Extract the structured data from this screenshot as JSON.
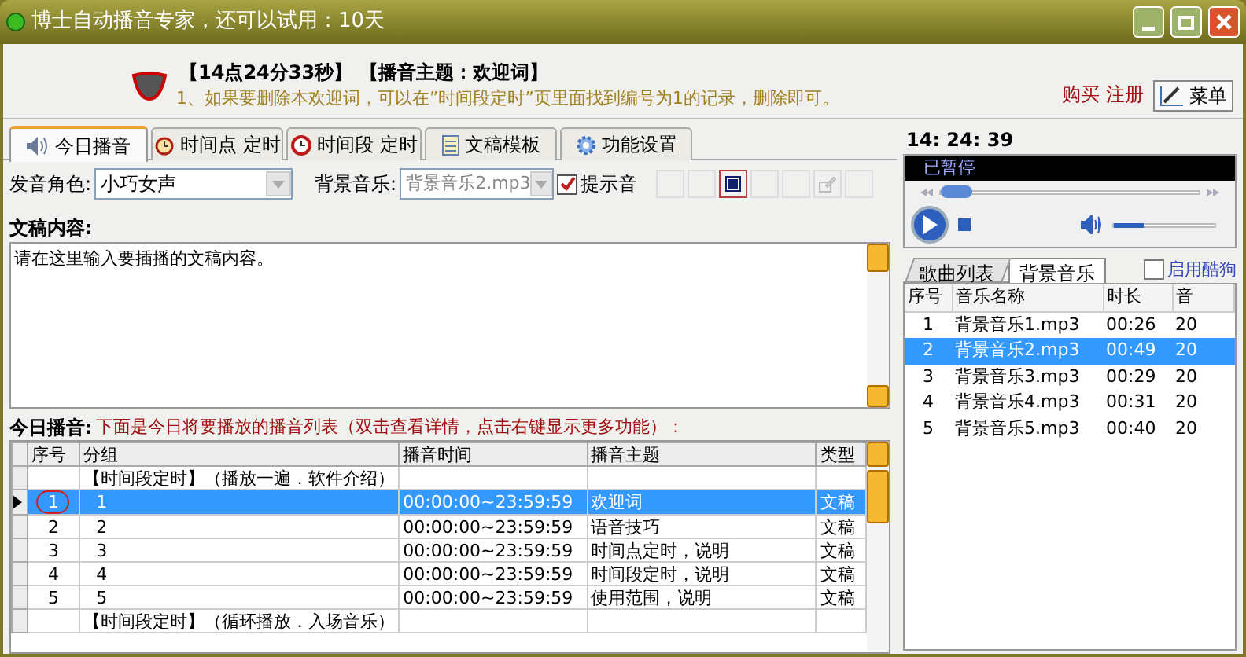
{
  "window": {
    "title": "博士自动播音专家，还可以试用：10天"
  },
  "header": {
    "headline": "【14点24分33秒】 【播音主题：欢迎词】",
    "hint": "1、如果要删除本欢迎词，可以在”时间段定时”页里面找到编号为1的记录，删除即可。",
    "links": [
      "购买",
      "注册"
    ],
    "menu_button": "菜单"
  },
  "tabs": [
    {
      "label": "今日播音",
      "selected": true
    },
    {
      "label": "时间点 定时",
      "selected": false
    },
    {
      "label": "时间段 定时",
      "selected": false
    },
    {
      "label": "文稿模板",
      "selected": false
    },
    {
      "label": "功能设置",
      "selected": false
    }
  ],
  "voice": {
    "label": "发音角色:",
    "value": "小巧女声"
  },
  "background_music": {
    "label": "背景音乐:",
    "value": "背景音乐2.mp3"
  },
  "prompt_tone": {
    "label": "提示音",
    "checked": true
  },
  "script": {
    "label": "文稿内容:",
    "placeholder": "请在这里输入要插播的文稿内容。"
  },
  "today": {
    "label": "今日播音:",
    "note": "下面是今日将要播放的播音列表（双击查看详情，点击右键显示更多功能）："
  },
  "table": {
    "columns": [
      "序号",
      "分组",
      "播音时间",
      "播音主题",
      "类型"
    ],
    "rows": [
      {
        "kind": "group",
        "cells": [
          "",
          "【时间段定时】（播放一遍．软件介绍）",
          "",
          "",
          ""
        ],
        "selected": false
      },
      {
        "kind": "item",
        "cells": [
          "1",
          "1",
          "00:00:00~23:59:59",
          "欢迎词",
          "文稿"
        ],
        "selected": true
      },
      {
        "kind": "item",
        "cells": [
          "2",
          "2",
          "00:00:00~23:59:59",
          "语音技巧",
          "文稿"
        ],
        "selected": false
      },
      {
        "kind": "item",
        "cells": [
          "3",
          "3",
          "00:00:00~23:59:59",
          "时间点定时，说明",
          "文稿"
        ],
        "selected": false
      },
      {
        "kind": "item",
        "cells": [
          "4",
          "4",
          "00:00:00~23:59:59",
          "时间段定时，说明",
          "文稿"
        ],
        "selected": false
      },
      {
        "kind": "item",
        "cells": [
          "5",
          "5",
          "00:00:00~23:59:59",
          "使用范围，说明",
          "文稿"
        ],
        "selected": false
      },
      {
        "kind": "group",
        "cells": [
          "",
          "【时间段定时】（循环播放．入场音乐）",
          "",
          "",
          ""
        ],
        "selected": false
      }
    ]
  },
  "clock": "14: 24: 39",
  "player": {
    "status": "已暂停",
    "seek": {
      "level": 0.12
    },
    "volume": {
      "level": 0.3
    }
  },
  "music_tabs": [
    {
      "label": "歌曲列表",
      "selected": false
    },
    {
      "label": "背景音乐",
      "selected": true
    }
  ],
  "kugou": {
    "label": "启用酷狗",
    "checked": false
  },
  "music_table": {
    "columns": [
      "序号",
      "音乐名称",
      "时长",
      "音"
    ],
    "rows": [
      {
        "cells": [
          "1",
          "背景音乐1.mp3",
          "00:26",
          "20"
        ],
        "selected": false
      },
      {
        "cells": [
          "2",
          "背景音乐2.mp3",
          "00:49",
          "20"
        ],
        "selected": true
      },
      {
        "cells": [
          "3",
          "背景音乐3.mp3",
          "00:29",
          "20"
        ],
        "selected": false
      },
      {
        "cells": [
          "4",
          "背景音乐4.mp3",
          "00:31",
          "20"
        ],
        "selected": false
      },
      {
        "cells": [
          "5",
          "背景音乐5.mp3",
          "00:40",
          "20"
        ],
        "selected": false
      }
    ]
  }
}
